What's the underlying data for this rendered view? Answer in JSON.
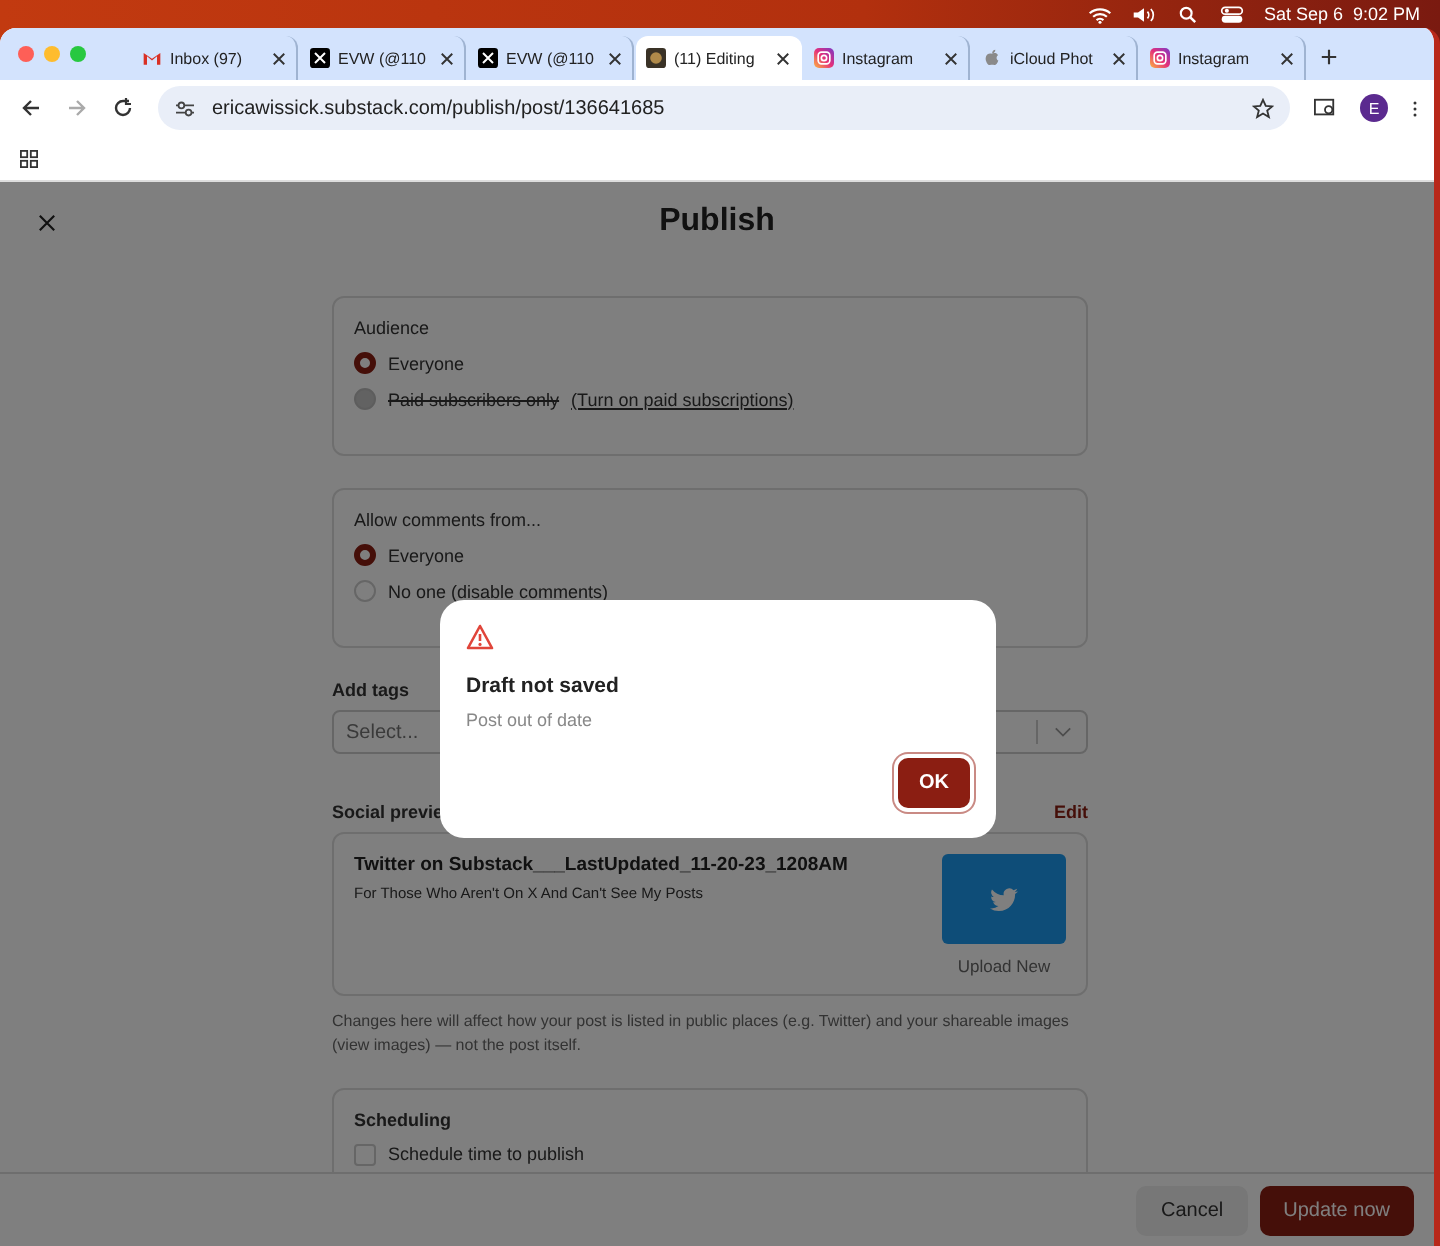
{
  "menu_bar": {
    "clock": "Sat Sep 6  9:02 PM"
  },
  "tabs": [
    {
      "title": "Inbox (97)",
      "kind": "mail",
      "selected": false
    },
    {
      "title": "EVW (@110",
      "kind": "x",
      "selected": false
    },
    {
      "title": "EVW (@110",
      "kind": "x",
      "selected": false
    },
    {
      "title": "(11) Editing",
      "kind": "site",
      "selected": true
    },
    {
      "title": "Instagram",
      "kind": "camera",
      "selected": false
    },
    {
      "title": "iCloud Phot",
      "kind": "apple",
      "selected": false
    },
    {
      "title": "Instagram",
      "kind": "camera",
      "selected": false
    }
  ],
  "address_bar": {
    "url": "ericawissick.substack.com/publish/post/136641685",
    "profile": "E"
  },
  "page": {
    "title": "Publish",
    "audience": {
      "label": "Audience",
      "options": [
        {
          "label": "Everyone",
          "selected": true,
          "disabled": false
        },
        {
          "label": "Paid subscribers only",
          "selected": false,
          "disabled": true,
          "link": "(Turn on paid subscriptions)"
        }
      ]
    },
    "comments": {
      "label": "Allow comments from...",
      "options": [
        {
          "label": "Everyone",
          "selected": true,
          "disabled": false
        },
        {
          "label": "No one (disable comments)",
          "selected": false,
          "disabled": false
        }
      ]
    },
    "tags": {
      "label": "Add tags",
      "placeholder": "Select..."
    },
    "social_preview": {
      "label": "Social previe",
      "edit": "Edit",
      "title": "Twitter on Substack___LastUpdated_11-20-23_1208AM",
      "subtitle": "For Those Who Aren't On X And Can't See My Posts",
      "upload": "Upload New"
    },
    "note": "Changes here will affect how your post is listed in public places (e.g. Twitter) and your shareable images (view images) — not the post itself.",
    "scheduling": {
      "label": "Scheduling",
      "option": {
        "label": "Schedule time to publish",
        "checked": false
      }
    },
    "buttons": [
      "Cancel",
      "Update now"
    ]
  },
  "dialog": {
    "title": "Draft not saved",
    "message": "Post out of date",
    "button": "OK"
  }
}
